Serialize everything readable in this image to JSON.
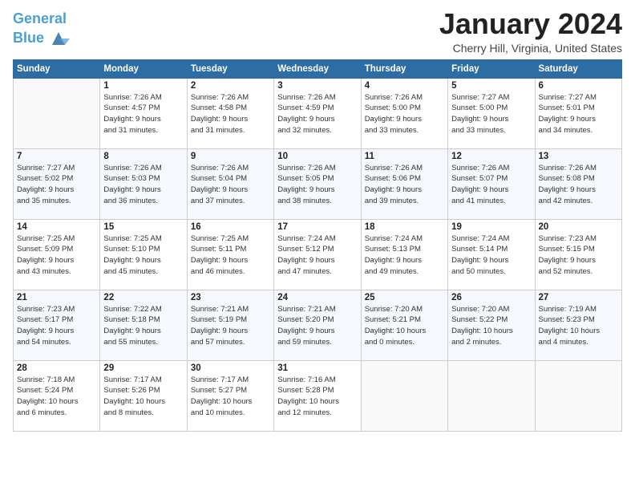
{
  "header": {
    "logo_line1": "General",
    "logo_line2": "Blue",
    "title": "January 2024",
    "location": "Cherry Hill, Virginia, United States"
  },
  "columns": [
    "Sunday",
    "Monday",
    "Tuesday",
    "Wednesday",
    "Thursday",
    "Friday",
    "Saturday"
  ],
  "weeks": [
    [
      {
        "num": "",
        "info": ""
      },
      {
        "num": "1",
        "info": "Sunrise: 7:26 AM\nSunset: 4:57 PM\nDaylight: 9 hours\nand 31 minutes."
      },
      {
        "num": "2",
        "info": "Sunrise: 7:26 AM\nSunset: 4:58 PM\nDaylight: 9 hours\nand 31 minutes."
      },
      {
        "num": "3",
        "info": "Sunrise: 7:26 AM\nSunset: 4:59 PM\nDaylight: 9 hours\nand 32 minutes."
      },
      {
        "num": "4",
        "info": "Sunrise: 7:26 AM\nSunset: 5:00 PM\nDaylight: 9 hours\nand 33 minutes."
      },
      {
        "num": "5",
        "info": "Sunrise: 7:27 AM\nSunset: 5:00 PM\nDaylight: 9 hours\nand 33 minutes."
      },
      {
        "num": "6",
        "info": "Sunrise: 7:27 AM\nSunset: 5:01 PM\nDaylight: 9 hours\nand 34 minutes."
      }
    ],
    [
      {
        "num": "7",
        "info": "Sunrise: 7:27 AM\nSunset: 5:02 PM\nDaylight: 9 hours\nand 35 minutes."
      },
      {
        "num": "8",
        "info": "Sunrise: 7:26 AM\nSunset: 5:03 PM\nDaylight: 9 hours\nand 36 minutes."
      },
      {
        "num": "9",
        "info": "Sunrise: 7:26 AM\nSunset: 5:04 PM\nDaylight: 9 hours\nand 37 minutes."
      },
      {
        "num": "10",
        "info": "Sunrise: 7:26 AM\nSunset: 5:05 PM\nDaylight: 9 hours\nand 38 minutes."
      },
      {
        "num": "11",
        "info": "Sunrise: 7:26 AM\nSunset: 5:06 PM\nDaylight: 9 hours\nand 39 minutes."
      },
      {
        "num": "12",
        "info": "Sunrise: 7:26 AM\nSunset: 5:07 PM\nDaylight: 9 hours\nand 41 minutes."
      },
      {
        "num": "13",
        "info": "Sunrise: 7:26 AM\nSunset: 5:08 PM\nDaylight: 9 hours\nand 42 minutes."
      }
    ],
    [
      {
        "num": "14",
        "info": "Sunrise: 7:25 AM\nSunset: 5:09 PM\nDaylight: 9 hours\nand 43 minutes."
      },
      {
        "num": "15",
        "info": "Sunrise: 7:25 AM\nSunset: 5:10 PM\nDaylight: 9 hours\nand 45 minutes."
      },
      {
        "num": "16",
        "info": "Sunrise: 7:25 AM\nSunset: 5:11 PM\nDaylight: 9 hours\nand 46 minutes."
      },
      {
        "num": "17",
        "info": "Sunrise: 7:24 AM\nSunset: 5:12 PM\nDaylight: 9 hours\nand 47 minutes."
      },
      {
        "num": "18",
        "info": "Sunrise: 7:24 AM\nSunset: 5:13 PM\nDaylight: 9 hours\nand 49 minutes."
      },
      {
        "num": "19",
        "info": "Sunrise: 7:24 AM\nSunset: 5:14 PM\nDaylight: 9 hours\nand 50 minutes."
      },
      {
        "num": "20",
        "info": "Sunrise: 7:23 AM\nSunset: 5:15 PM\nDaylight: 9 hours\nand 52 minutes."
      }
    ],
    [
      {
        "num": "21",
        "info": "Sunrise: 7:23 AM\nSunset: 5:17 PM\nDaylight: 9 hours\nand 54 minutes."
      },
      {
        "num": "22",
        "info": "Sunrise: 7:22 AM\nSunset: 5:18 PM\nDaylight: 9 hours\nand 55 minutes."
      },
      {
        "num": "23",
        "info": "Sunrise: 7:21 AM\nSunset: 5:19 PM\nDaylight: 9 hours\nand 57 minutes."
      },
      {
        "num": "24",
        "info": "Sunrise: 7:21 AM\nSunset: 5:20 PM\nDaylight: 9 hours\nand 59 minutes."
      },
      {
        "num": "25",
        "info": "Sunrise: 7:20 AM\nSunset: 5:21 PM\nDaylight: 10 hours\nand 0 minutes."
      },
      {
        "num": "26",
        "info": "Sunrise: 7:20 AM\nSunset: 5:22 PM\nDaylight: 10 hours\nand 2 minutes."
      },
      {
        "num": "27",
        "info": "Sunrise: 7:19 AM\nSunset: 5:23 PM\nDaylight: 10 hours\nand 4 minutes."
      }
    ],
    [
      {
        "num": "28",
        "info": "Sunrise: 7:18 AM\nSunset: 5:24 PM\nDaylight: 10 hours\nand 6 minutes."
      },
      {
        "num": "29",
        "info": "Sunrise: 7:17 AM\nSunset: 5:26 PM\nDaylight: 10 hours\nand 8 minutes."
      },
      {
        "num": "30",
        "info": "Sunrise: 7:17 AM\nSunset: 5:27 PM\nDaylight: 10 hours\nand 10 minutes."
      },
      {
        "num": "31",
        "info": "Sunrise: 7:16 AM\nSunset: 5:28 PM\nDaylight: 10 hours\nand 12 minutes."
      },
      {
        "num": "",
        "info": ""
      },
      {
        "num": "",
        "info": ""
      },
      {
        "num": "",
        "info": ""
      }
    ]
  ]
}
